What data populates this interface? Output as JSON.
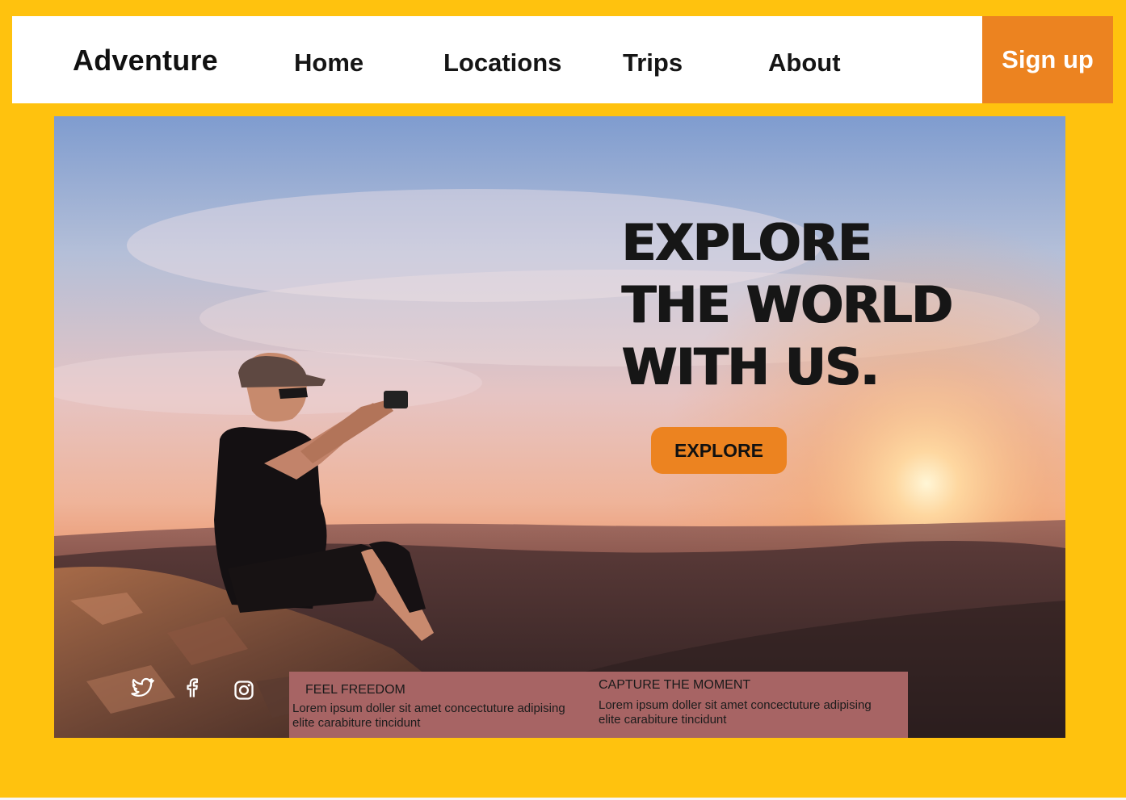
{
  "nav": {
    "brand": "Adventure",
    "links": [
      "Home",
      "Locations",
      "Trips",
      "About"
    ],
    "signup_label": "Sign up"
  },
  "hero": {
    "headline": [
      "EXPLORE",
      "THE WORLD",
      "WITH US."
    ],
    "explore_label": "EXPLORE",
    "image_description": "person with camera sitting on rock at sunset overlooking hills"
  },
  "social": {
    "icons": [
      "twitter-icon",
      "facebook-icon",
      "instagram-icon"
    ]
  },
  "features": [
    {
      "title": "FEEL  FREEDOM",
      "text": "Lorem ipsum doller sit  amet concectuture adipising elite carabiture tincidunt"
    },
    {
      "title": "CAPTURE THE MOMENT",
      "text": "Lorem ipsum doller sit  amet concectuture adipising elite carabiture tincidunt"
    }
  ],
  "colors": {
    "background": "#ffc20e",
    "accent": "#ec8320",
    "panel": "#a76464",
    "nav": "#ffffff"
  }
}
